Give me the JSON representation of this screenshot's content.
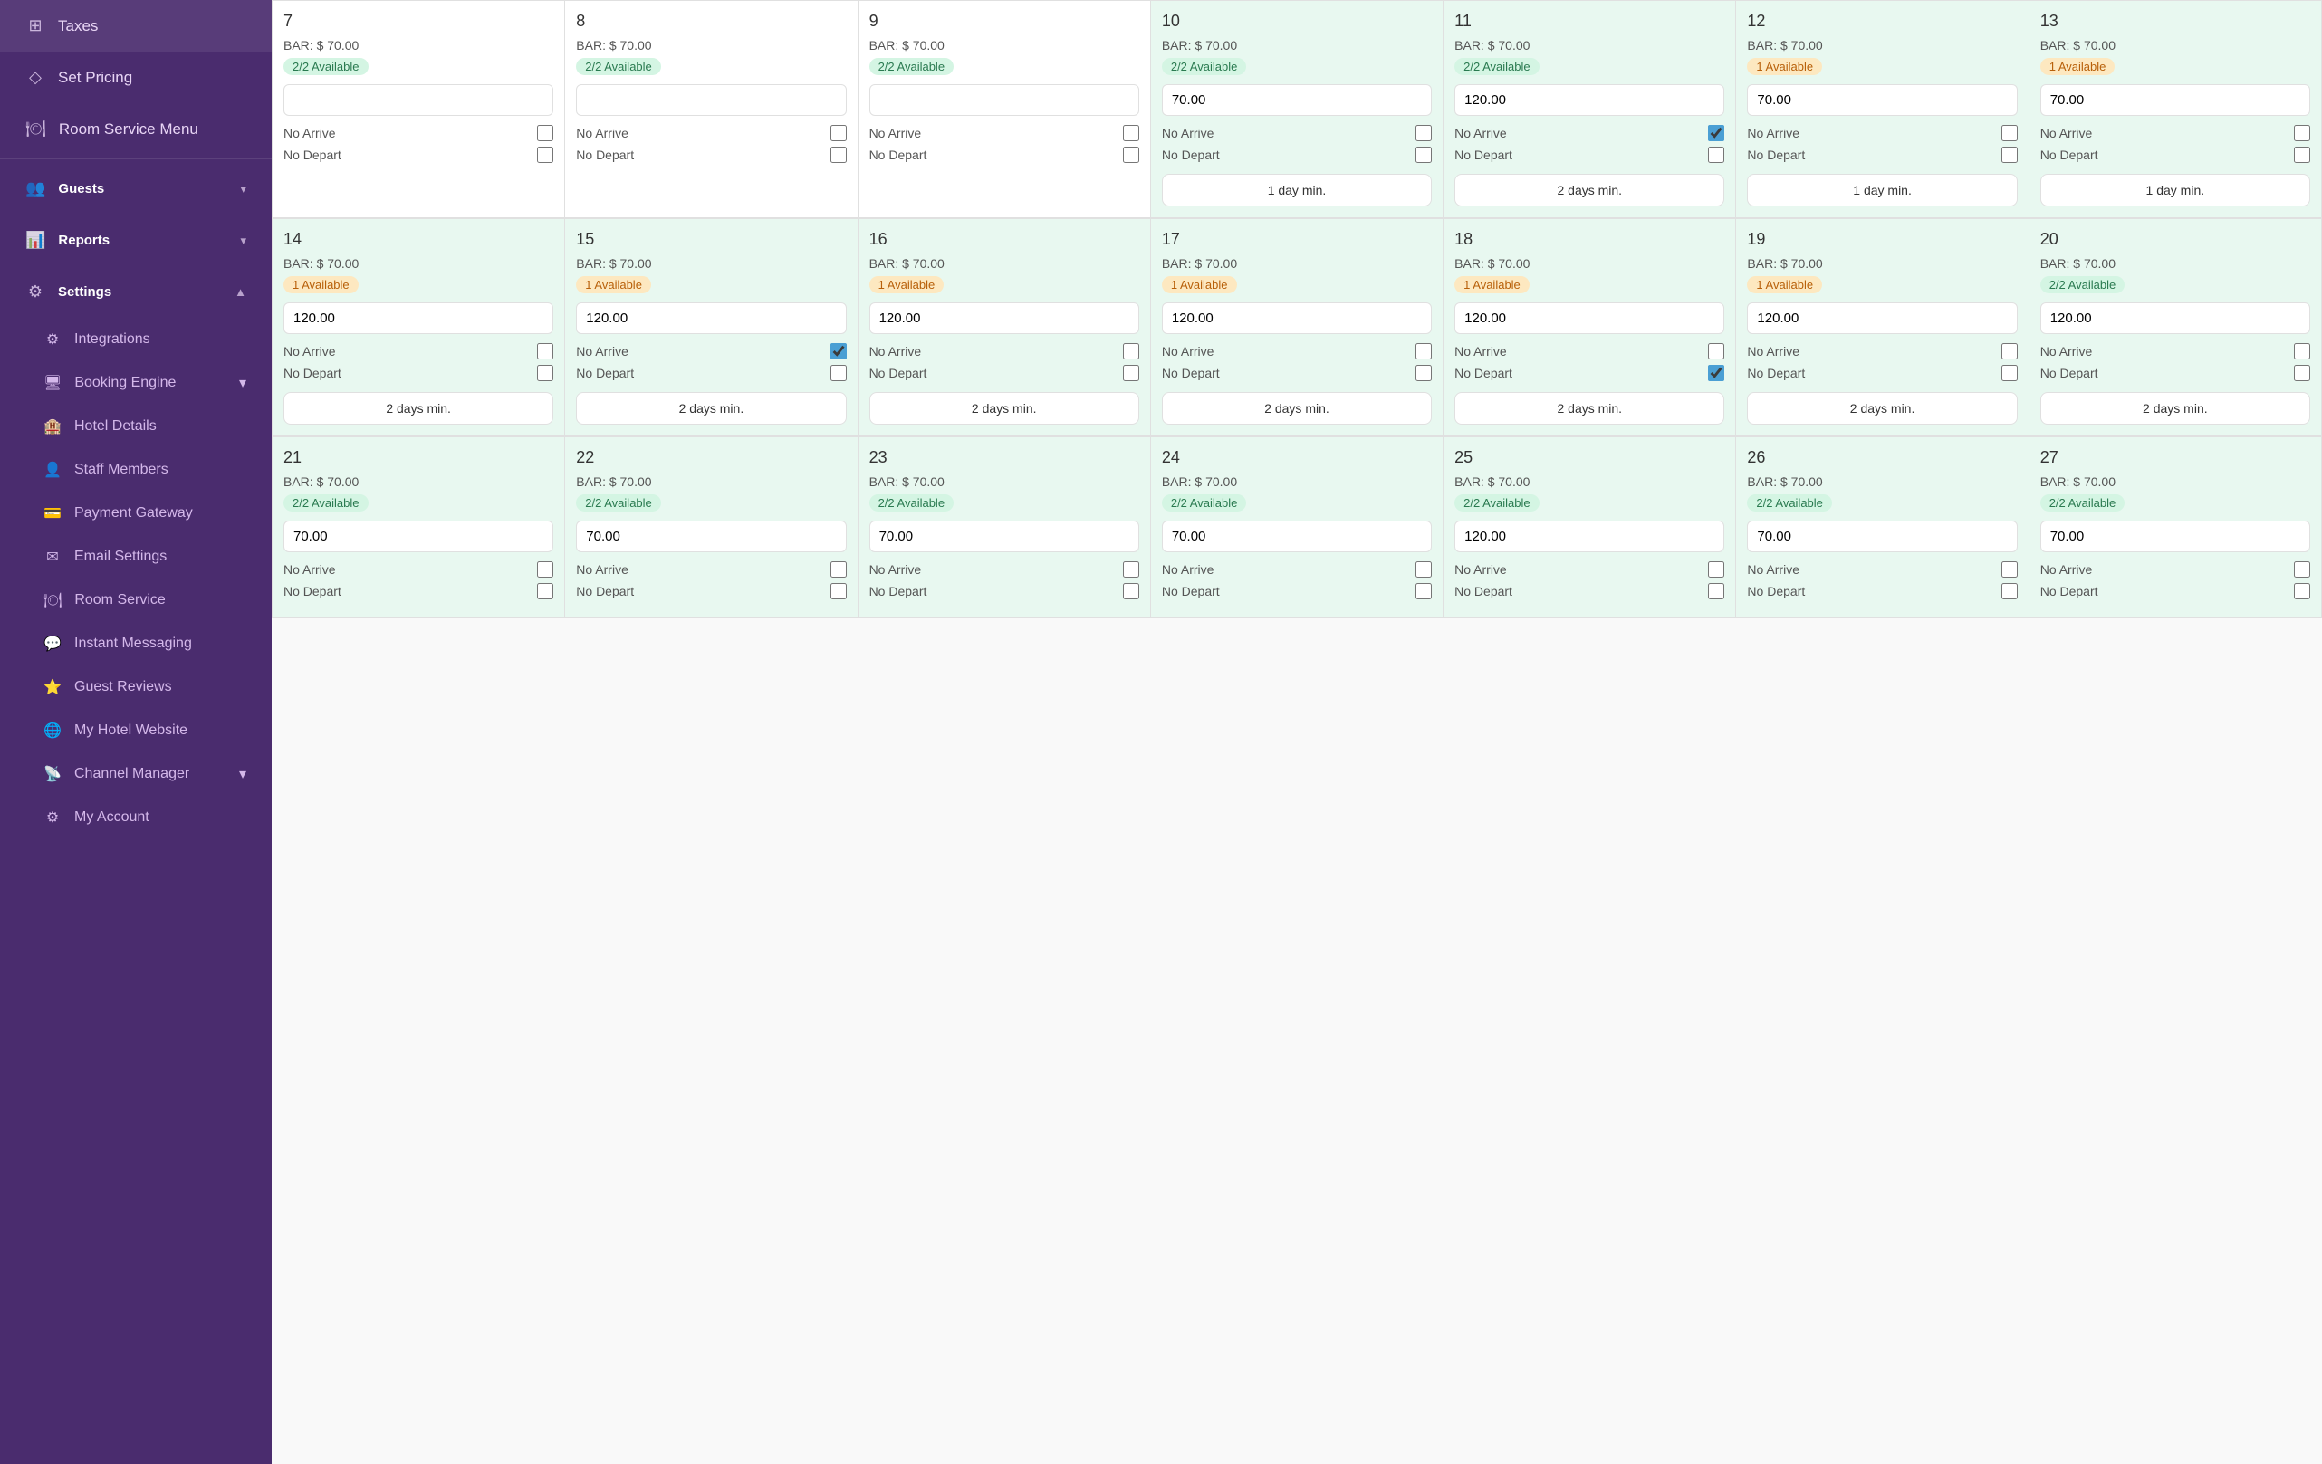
{
  "sidebar": {
    "items": [
      {
        "id": "taxes",
        "label": "Taxes",
        "icon": "⊞",
        "type": "item"
      },
      {
        "id": "set-pricing",
        "label": "Set Pricing",
        "icon": "◇",
        "type": "item"
      },
      {
        "id": "room-service-menu",
        "label": "Room Service Menu",
        "icon": "🍽",
        "type": "item"
      },
      {
        "id": "guests",
        "label": "Guests",
        "icon": "👥",
        "type": "section",
        "expanded": true
      },
      {
        "id": "reports",
        "label": "Reports",
        "icon": "📊",
        "type": "section",
        "expanded": true
      },
      {
        "id": "settings",
        "label": "Settings",
        "icon": "⚙",
        "type": "section",
        "expanded": true
      },
      {
        "id": "integrations",
        "label": "Integrations",
        "icon": "⚙",
        "type": "sub"
      },
      {
        "id": "booking-engine",
        "label": "Booking Engine",
        "icon": "🖥",
        "type": "sub-section",
        "expanded": true
      },
      {
        "id": "hotel-details",
        "label": "Hotel Details",
        "icon": "🏨",
        "type": "sub"
      },
      {
        "id": "staff-members",
        "label": "Staff Members",
        "icon": "👤",
        "type": "sub"
      },
      {
        "id": "payment-gateway",
        "label": "Payment Gateway",
        "icon": "💳",
        "type": "sub"
      },
      {
        "id": "email-settings",
        "label": "Email Settings",
        "icon": "✉",
        "type": "sub"
      },
      {
        "id": "room-service",
        "label": "Room Service",
        "icon": "🍽",
        "type": "sub"
      },
      {
        "id": "instant-messaging",
        "label": "Instant Messaging",
        "icon": "💬",
        "type": "sub"
      },
      {
        "id": "guest-reviews",
        "label": "Guest Reviews",
        "icon": "⭐",
        "type": "sub"
      },
      {
        "id": "my-hotel-website",
        "label": "My Hotel Website",
        "icon": "🌐",
        "type": "sub"
      },
      {
        "id": "channel-manager",
        "label": "Channel Manager",
        "icon": "📡",
        "type": "sub-section",
        "expanded": false
      },
      {
        "id": "my-account",
        "label": "My Account",
        "icon": "⚙",
        "type": "sub"
      }
    ]
  },
  "calendar": {
    "weeks": [
      {
        "days": [
          {
            "num": 7,
            "bar": "$ 70.00",
            "avail": "2/2 Available",
            "availType": "green",
            "price": "",
            "noArrive": false,
            "noDepart": false,
            "minStay": null,
            "bg": "white"
          },
          {
            "num": 8,
            "bar": "$ 70.00",
            "avail": "2/2 Available",
            "availType": "green",
            "price": "",
            "noArrive": false,
            "noDepart": false,
            "minStay": null,
            "bg": "white"
          },
          {
            "num": 9,
            "bar": "$ 70.00",
            "avail": "2/2 Available",
            "availType": "green",
            "price": "",
            "noArrive": false,
            "noDepart": false,
            "minStay": null,
            "bg": "white"
          },
          {
            "num": 10,
            "bar": "$ 70.00",
            "avail": "2/2 Available",
            "availType": "green",
            "price": "70.00",
            "noArrive": false,
            "noDepart": false,
            "minStay": "1 day min.",
            "bg": "green"
          },
          {
            "num": 11,
            "bar": "$ 70.00",
            "avail": "2/2 Available",
            "availType": "green",
            "price": "120.00",
            "noArrive": true,
            "noDepart": false,
            "minStay": "2 days min.",
            "bg": "green"
          },
          {
            "num": 12,
            "bar": "$ 70.00",
            "avail": "1 Available",
            "availType": "orange",
            "price": "70.00",
            "noArrive": false,
            "noDepart": false,
            "minStay": "1 day min.",
            "bg": "green"
          },
          {
            "num": 13,
            "bar": "$ 70.00",
            "avail": "1 Available",
            "availType": "orange",
            "price": "70.00",
            "noArrive": false,
            "noDepart": false,
            "minStay": "1 day min.",
            "bg": "green"
          }
        ]
      },
      {
        "days": [
          {
            "num": 14,
            "bar": "$ 70.00",
            "avail": "1 Available",
            "availType": "orange",
            "price": "120.00",
            "noArrive": false,
            "noDepart": false,
            "minStay": "2 days min.",
            "bg": "green"
          },
          {
            "num": 15,
            "bar": "$ 70.00",
            "avail": "1 Available",
            "availType": "orange",
            "price": "120.00",
            "noArrive": true,
            "noDepart": false,
            "minStay": "2 days min.",
            "bg": "green"
          },
          {
            "num": 16,
            "bar": "$ 70.00",
            "avail": "1 Available",
            "availType": "orange",
            "price": "120.00",
            "noArrive": false,
            "noDepart": false,
            "minStay": "2 days min.",
            "bg": "green"
          },
          {
            "num": 17,
            "bar": "$ 70.00",
            "avail": "1 Available",
            "availType": "orange",
            "price": "120.00",
            "noArrive": false,
            "noDepart": false,
            "minStay": "2 days min.",
            "bg": "green"
          },
          {
            "num": 18,
            "bar": "$ 70.00",
            "avail": "1 Available",
            "availType": "orange",
            "price": "120.00",
            "noArrive": false,
            "noDepart": true,
            "minStay": "2 days min.",
            "bg": "green"
          },
          {
            "num": 19,
            "bar": "$ 70.00",
            "avail": "1 Available",
            "availType": "orange",
            "price": "120.00",
            "noArrive": false,
            "noDepart": false,
            "minStay": "2 days min.",
            "bg": "green"
          },
          {
            "num": 20,
            "bar": "$ 70.00",
            "avail": "2/2 Available",
            "availType": "green",
            "price": "120.00",
            "noArrive": false,
            "noDepart": false,
            "minStay": "2 days min.",
            "bg": "green"
          }
        ]
      },
      {
        "days": [
          {
            "num": 21,
            "bar": "$ 70.00",
            "avail": "2/2 Available",
            "availType": "green",
            "price": "70.00",
            "noArrive": false,
            "noDepart": false,
            "minStay": null,
            "bg": "green"
          },
          {
            "num": 22,
            "bar": "$ 70.00",
            "avail": "2/2 Available",
            "availType": "green",
            "price": "70.00",
            "noArrive": false,
            "noDepart": false,
            "minStay": null,
            "bg": "green"
          },
          {
            "num": 23,
            "bar": "$ 70.00",
            "avail": "2/2 Available",
            "availType": "green",
            "price": "70.00",
            "noArrive": false,
            "noDepart": false,
            "minStay": null,
            "bg": "green"
          },
          {
            "num": 24,
            "bar": "$ 70.00",
            "avail": "2/2 Available",
            "availType": "green",
            "price": "70.00",
            "noArrive": false,
            "noDepart": false,
            "minStay": null,
            "bg": "green"
          },
          {
            "num": 25,
            "bar": "$ 70.00",
            "avail": "2/2 Available",
            "availType": "green",
            "price": "120.00",
            "noArrive": false,
            "noDepart": false,
            "minStay": null,
            "bg": "green"
          },
          {
            "num": 26,
            "bar": "$ 70.00",
            "avail": "2/2 Available",
            "availType": "green",
            "price": "70.00",
            "noArrive": false,
            "noDepart": false,
            "minStay": null,
            "bg": "green"
          },
          {
            "num": 27,
            "bar": "$ 70.00",
            "avail": "2/2 Available",
            "availType": "green",
            "price": "70.00",
            "noArrive": false,
            "noDepart": false,
            "minStay": null,
            "bg": "green"
          }
        ]
      }
    ],
    "labels": {
      "noArrive": "No Arrive",
      "noDepart": "No Depart",
      "bar": "BAR:"
    }
  }
}
